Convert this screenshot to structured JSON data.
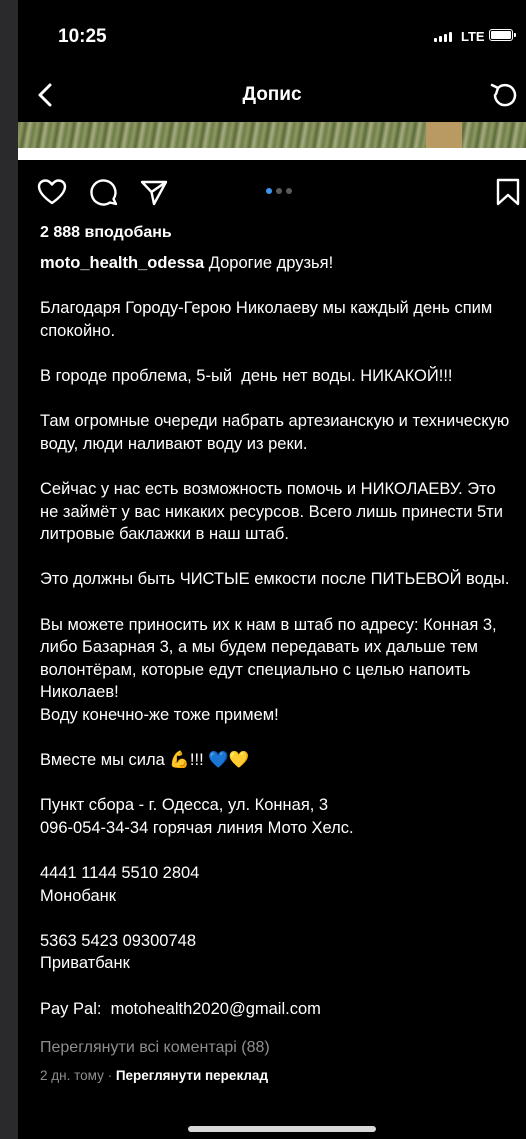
{
  "status_bar": {
    "time": "10:25",
    "network": "LTE"
  },
  "nav": {
    "title": "Допис"
  },
  "post": {
    "likes": "2 888 вподобань",
    "username": "moto_health_odessa",
    "caption": " Дорогие друзья!\n\nБлагодаря Городу-Герою Николаеву мы каждый день спим спокойно.\n\nВ городе проблема, 5-ый  день нет воды. НИКАКОЙ!!!\n\nТам огромные очереди набрать артезианскую и техническую воду, люди наливают воду из реки.\n\nСейчас у нас есть возможность помочь и НИКОЛАЕВУ. Это не займёт у вас никаких ресурсов. Всего лишь принести 5ти литровые баклажки в наш штаб.\n\nЭто должны быть ЧИСТЫЕ емкости после ПИТЬЕВОЙ воды.\n\nВы можете приносить их к нам в штаб по адресу: Конная 3, либо Базарная 3, а мы будем передавать их дальше тем волонтёрам, которые едут специально с целью напоить Николаев!\nВоду конечно-же тоже примем!\n\nВместе мы сила 💪!!! 💙💛\n\nПункт сбора - г. Одесса, ул. Конная, 3\n096-054-34-34 горячая линия Мото Хелс.\n\n4441 1144 5510 2804\nМонобанк\n\n5363 5423 09300748\nПриватбанк\n\nPay Pal:  motohealth2020@gmail.com",
    "view_comments": "Переглянути всі коментарі (88)",
    "time_ago": "2 дн. тому",
    "separator": " · ",
    "translate": "Переглянути переклад"
  },
  "carousel": {
    "total": 3,
    "active": 1
  },
  "colors": {
    "background": "#000000",
    "accent": "#3b97f0",
    "muted": "#8e8e8e"
  },
  "icons": [
    "back-icon",
    "refresh-icon",
    "heart-icon",
    "comment-icon",
    "share-icon",
    "bookmark-icon"
  ]
}
